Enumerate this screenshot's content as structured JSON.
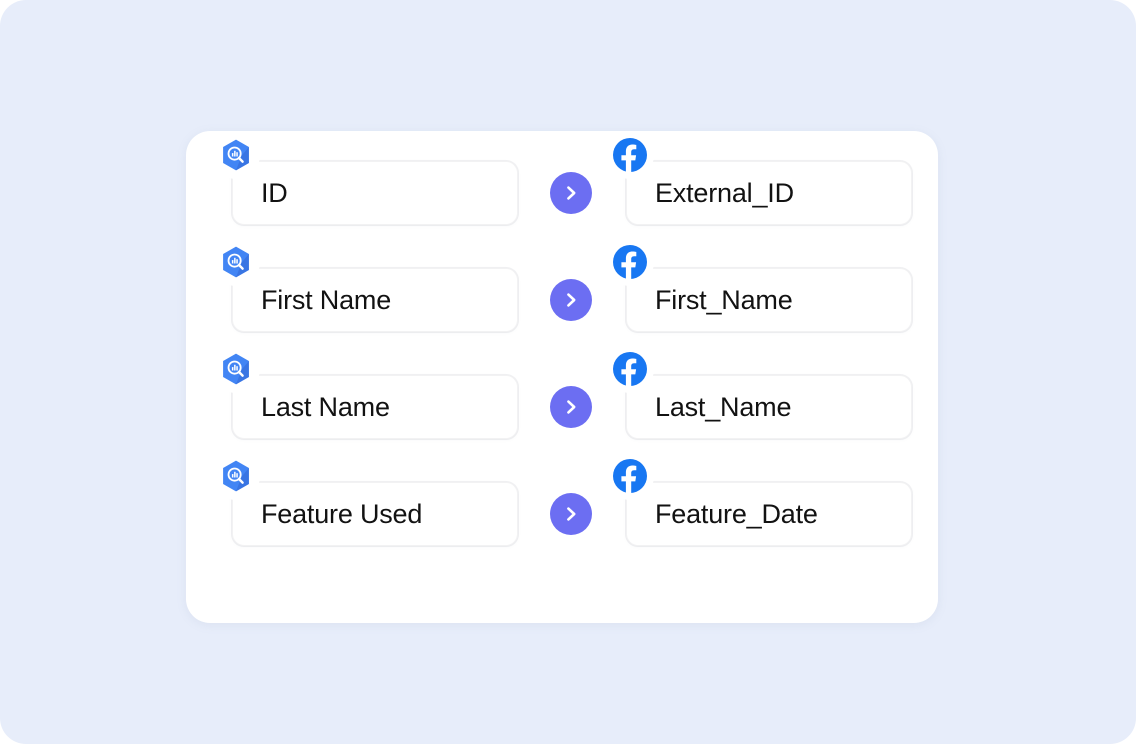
{
  "page": {
    "background_color": "#e7edfa",
    "card_background_color": "#ffffff"
  },
  "colors": {
    "arrow_badge": "#6c6ef2",
    "facebook_blue": "#1877f2",
    "bigquery_blue": "#4285f4",
    "bigquery_blue_dark": "#3367d6",
    "field_text": "#121212",
    "field_border": "#f2f2f3"
  },
  "mapping": {
    "source_platform": "bigquery",
    "target_platform": "facebook",
    "source_icon_name": "bigquery-icon",
    "target_icon_name": "facebook-icon",
    "connector_icon_name": "chevron-right-icon",
    "rows": [
      {
        "source_field": "ID",
        "target_field": "External_ID"
      },
      {
        "source_field": "First Name",
        "target_field": "First_Name"
      },
      {
        "source_field": "Last Name",
        "target_field": "Last_Name"
      },
      {
        "source_field": "Feature Used",
        "target_field": "Feature_Date"
      }
    ]
  }
}
